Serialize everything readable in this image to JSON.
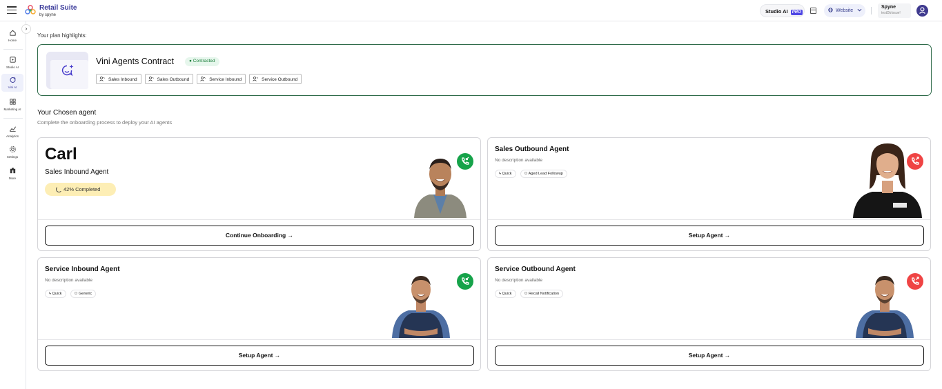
{
  "header": {
    "brand_title": "Retail Suite",
    "brand_sub": "by spyne",
    "studio_label": "Studio AI",
    "pro_badge": "PRO",
    "website_label": "Website",
    "user_name": "Spyne",
    "user_email": "testDbIssue!"
  },
  "sidebar": {
    "items": [
      {
        "label": "Home",
        "icon": "home-icon"
      },
      {
        "label": "Studio AI",
        "icon": "studio-icon"
      },
      {
        "label": "Vini AI",
        "icon": "vini-icon"
      },
      {
        "label": "Marketing AI",
        "icon": "marketing-icon"
      },
      {
        "label": "Analytics",
        "icon": "analytics-icon"
      },
      {
        "label": "Settings",
        "icon": "settings-icon"
      },
      {
        "label": "More",
        "icon": "more-icon"
      }
    ]
  },
  "plan": {
    "section_label": "Your plan highlights:",
    "title": "Vini Agents Contract",
    "status": "Contracted",
    "tags": [
      "Sales Inbound",
      "Sales Outbound",
      "Service Inbound",
      "Service Outbound"
    ]
  },
  "chosen": {
    "title": "Your Chosen agent",
    "subtitle": "Complete the onboarding process to deploy your AI agents"
  },
  "agents": [
    {
      "name": "Carl",
      "role": "Sales Inbound Agent",
      "progress_label": "42% Completed",
      "progress": 0.42,
      "button": "Continue Onboarding →",
      "call": "inbound"
    },
    {
      "name": "Sales Outbound Agent",
      "desc": "No description available",
      "tags": [
        "Quick",
        "Aged Lead Followup"
      ],
      "button": "Setup Agent →",
      "call": "outbound"
    },
    {
      "name": "Service Inbound Agent",
      "desc": "No description available",
      "tags": [
        "Quick",
        "Generic"
      ],
      "button": "Setup Agent →",
      "call": "inbound"
    },
    {
      "name": "Service Outbound Agent",
      "desc": "No description available",
      "tags": [
        "Quick",
        "Recall Notification"
      ],
      "button": "Setup Agent →",
      "call": "outbound"
    }
  ],
  "colors": {
    "brand": "#3b3b9a",
    "plan_border": "#2f6b4a",
    "inbound": "#16a34a",
    "outbound": "#ef4444",
    "progress_bg": "#fdeeb5"
  }
}
